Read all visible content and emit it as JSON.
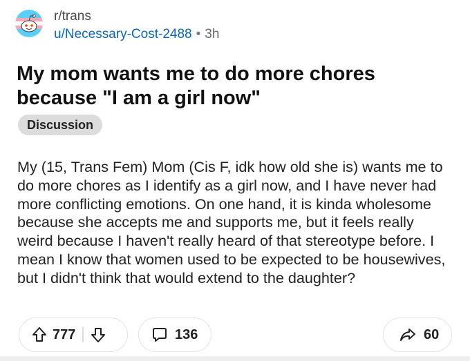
{
  "header": {
    "subreddit": "r/trans",
    "username": "u/Necessary-Cost-2488",
    "separator": "•",
    "age": "3h"
  },
  "post": {
    "title": "My mom wants me to do more chores because \"I am a girl now\"",
    "flair": "Discussion",
    "body": "My (15, Trans Fem) Mom (Cis F, idk how old she is) wants me to do more chores as I identify as a girl now, and I have never had more conflicting emotions. On one hand, it is kinda wholesome because she accepts me and supports me, but it feels really weird because I haven't really heard of that stereotype before. I mean I know that women used to be expected to be housewives, but I didn't think that would extend to the daughter?"
  },
  "actions": {
    "upvotes": "777",
    "comments": "136",
    "shares": "60"
  },
  "icons": {
    "avatar": "trans-flag-snoo-icon",
    "upvote": "arrow-up-icon",
    "downvote": "arrow-down-icon",
    "comment": "speech-bubble-icon",
    "share": "share-arrow-icon"
  },
  "colors": {
    "username": "#0a66c2",
    "trans_blue": "#5BCEFA",
    "trans_pink": "#F5A9B8",
    "flair_bg": "#dcdcdc"
  }
}
